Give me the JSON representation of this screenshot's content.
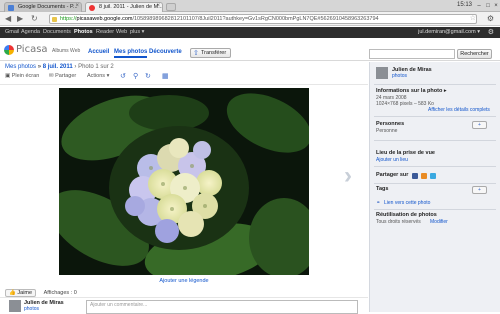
{
  "browser": {
    "tabs": [
      {
        "label": "Google Documents - P..."
      },
      {
        "label": "8 juil. 2011 - Julien de M..."
      }
    ],
    "clock": "15:13",
    "url": {
      "scheme": "https://",
      "host": "picasaweb.google.com",
      "rest": "/105898989682812101107/8Juil2011?authkey=Gv1sRgCN000bmPgLN7QE#5626910458963263794"
    }
  },
  "gbar": {
    "links": [
      "Gmail",
      "Agenda",
      "Documents",
      "Photos",
      "Reader",
      "Web",
      "plus ▾"
    ],
    "active": "Photos",
    "user": "jul.demiran@gmail.com ▾"
  },
  "header": {
    "logo_word": "Picasa",
    "logo_sub": "Albums Web",
    "tabs": [
      "Accueil",
      "Mes photos",
      "Découverte"
    ],
    "upload": "Transférer",
    "search_button": "Rechercher"
  },
  "crumb": {
    "root": "Mes photos",
    "sep": " » ",
    "album": "8 juil. 2011",
    "photo": " › Photo 1 sur 2"
  },
  "actions": {
    "fullscreen": "Plein écran",
    "share": "Partager",
    "actions": "Actions ▾"
  },
  "photo": {
    "caption": "Ajouter une légende"
  },
  "social": {
    "like": "Jaime",
    "views": "Affichages : 0"
  },
  "comment": {
    "name": "Julien de Miras",
    "photos": "photos",
    "placeholder": "Ajouter un commentaire..."
  },
  "sidebar": {
    "name": "Julien de Miras",
    "photos": "photos",
    "info_title": "Informations sur la photo ▸",
    "info_date": "24 mars 2008",
    "info_size": "1024×768 pixels – 583 Ko",
    "info_link": "Afficher les détails complets",
    "people_title": "Personnes",
    "people_value": "Personne",
    "place_title": "Lieu de la prise de vue",
    "place_link": "Ajouter un lieu",
    "share_title": "Partager sur",
    "tags_title": "Tags",
    "link_text": "Lien vers cette photo",
    "reuse_title": "Réutilisation de photos",
    "reuse_value": "Tous droits réservés",
    "reuse_link": "Modifier",
    "plus": "+"
  }
}
